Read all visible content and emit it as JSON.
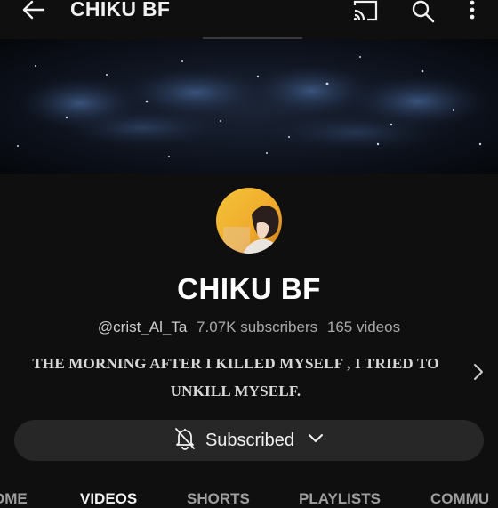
{
  "header": {
    "title": "CHIKU BF",
    "icons": [
      "back-arrow-icon",
      "cast-icon",
      "search-icon",
      "more-vert-icon"
    ]
  },
  "channel": {
    "name": "CHIKU BF",
    "handle": "@crist_Al_Ta",
    "subscribers": "7.07K subscribers",
    "videos": "165 videos",
    "description_line1": "THE MORNING AFTER I KILLED MYSELF , I TRIED TO",
    "description_line2": "UNKILL MYSELF."
  },
  "subscribe_button": {
    "label": "Subscribed",
    "icons": [
      "bell-off-icon",
      "chevron-down-icon"
    ]
  },
  "tabs": [
    {
      "label": "OME"
    },
    {
      "label": "VIDEOS",
      "active": true
    },
    {
      "label": "SHORTS"
    },
    {
      "label": "PLAYLISTS"
    },
    {
      "label": "COMMU"
    }
  ],
  "colors": {
    "background": "#0f0f0f",
    "button_background": "#272727",
    "secondary_text": "#aaaaaa"
  }
}
